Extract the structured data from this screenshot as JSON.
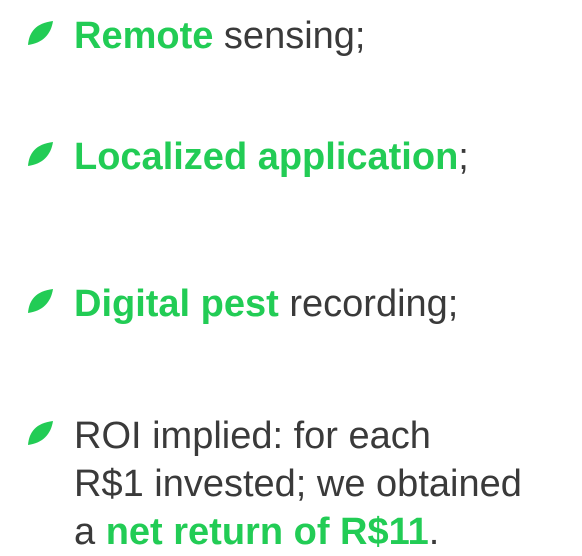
{
  "accent_color": "#22cc55",
  "bullet_icon": "leaf-icon",
  "bullets": [
    {
      "highlight": "Remote",
      "rest": " sensing;"
    },
    {
      "highlight": "Localized application",
      "rest": ";"
    },
    {
      "highlight": "Digital pest",
      "rest": " recording;"
    },
    {
      "line1": "ROI implied: for each",
      "line2": "R$1 invested; we obtained",
      "line3_prefix": "a ",
      "line3_highlight": "net return of R$11",
      "line3_suffix": "."
    }
  ]
}
